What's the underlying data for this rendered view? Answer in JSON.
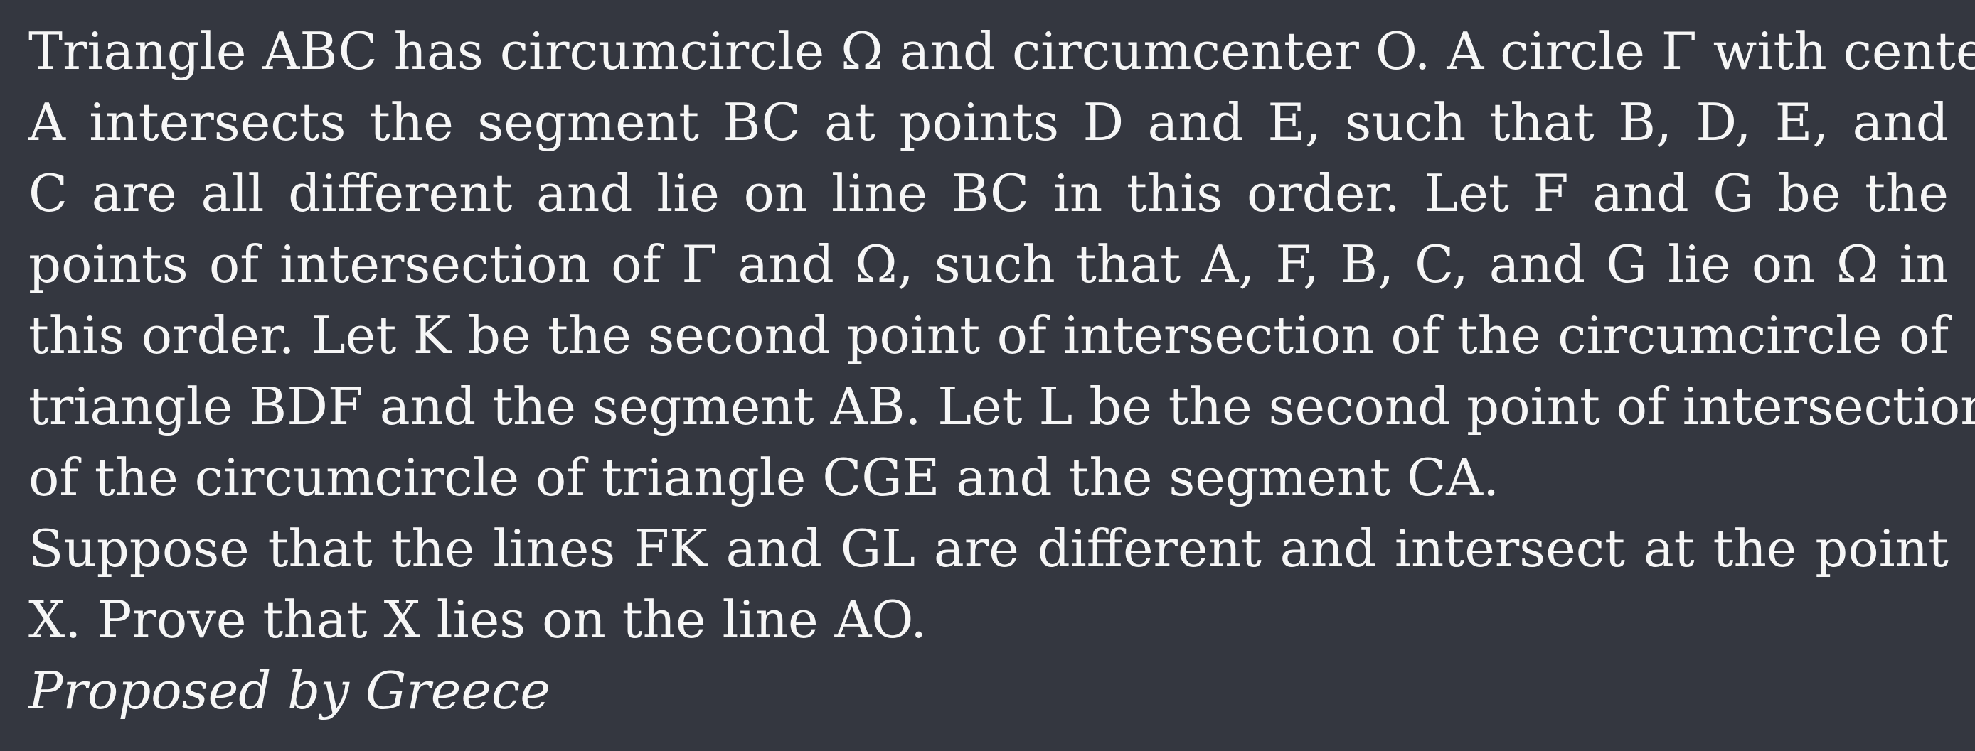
{
  "problem": {
    "paragraph1_lines": [
      "Triangle ABC has circumcircle Ω and circumcenter O. A circle Γ with center",
      "A intersects the segment BC at points D and E, such that B, D, E, and",
      "C are all different and lie on line BC in this order. Let F and G be the",
      "points of intersection of Γ and Ω, such that A, F, B, C, and G lie on Ω in",
      "this order. Let K be the second point of intersection of the circumcircle of",
      "triangle BDF and the segment AB. Let L be the second point of intersection",
      "of the circumcircle of triangle CGE and the segment CA."
    ],
    "paragraph2_lines": [
      "Suppose that the lines FK and GL are different and intersect at the point",
      "X. Prove that X lies on the line AO."
    ],
    "attribution": "Proposed by Greece"
  }
}
